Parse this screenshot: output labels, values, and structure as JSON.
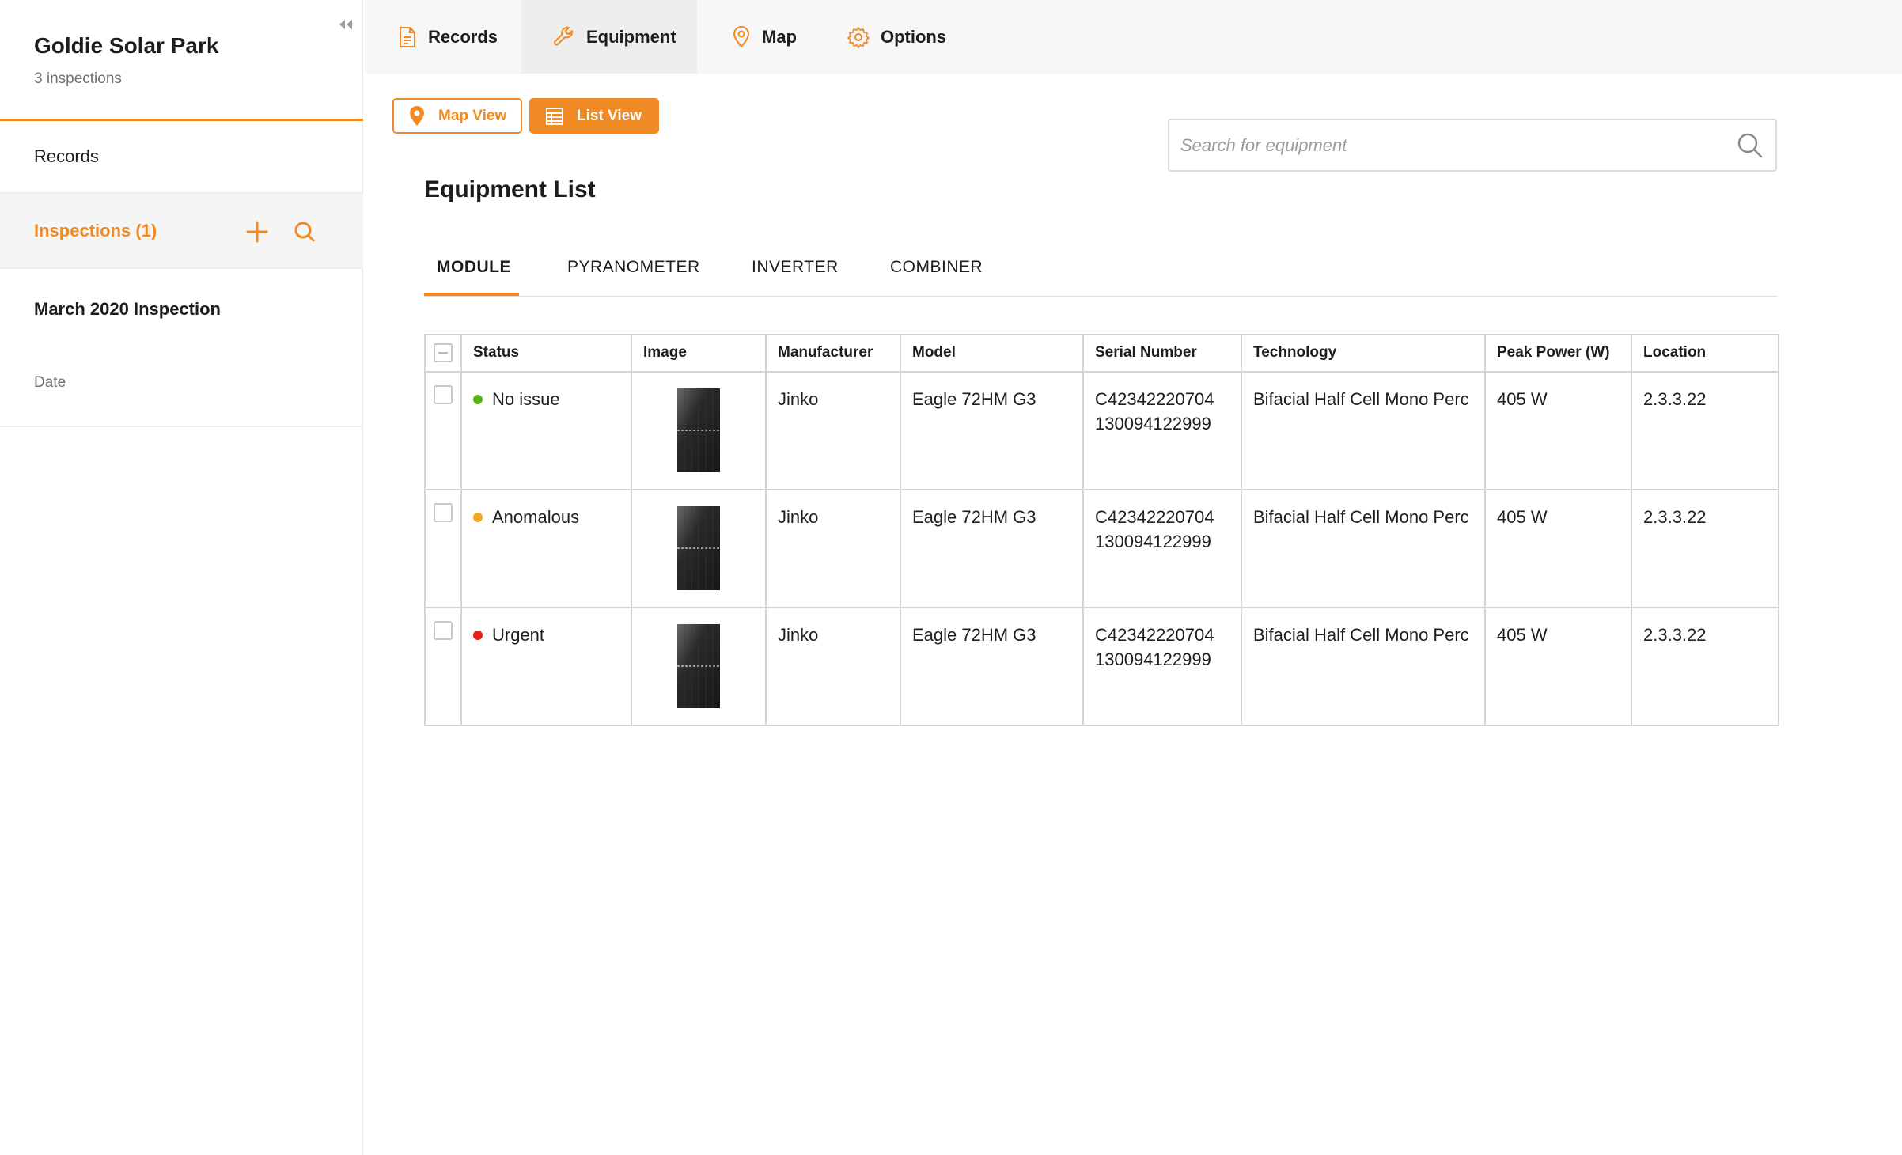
{
  "sidebar": {
    "site_title": "Goldie Solar Park",
    "site_subtitle": "3 inspections",
    "records_label": "Records",
    "inspections_label": "Inspections (1)",
    "inspection_item": {
      "title": "March 2020 Inspection",
      "date_label": "Date"
    }
  },
  "nav": {
    "tabs": [
      {
        "label": "Records",
        "icon": "document-icon"
      },
      {
        "label": "Equipment",
        "icon": "wrench-icon"
      },
      {
        "label": "Map",
        "icon": "map-pin-icon"
      },
      {
        "label": "Options",
        "icon": "gear-icon"
      }
    ],
    "active": "Equipment"
  },
  "view_toggle": {
    "map_label": "Map View",
    "list_label": "List View",
    "active": "List View"
  },
  "search": {
    "placeholder": "Search for equipment",
    "value": ""
  },
  "equipment": {
    "title": "Equipment List",
    "tabs": [
      "MODULE",
      "PYRANOMETER",
      "INVERTER",
      "COMBINER"
    ],
    "active_tab": "MODULE"
  },
  "table": {
    "columns": [
      "Status",
      "Image",
      "Manufacturer",
      "Model",
      "Serial Number",
      "Technology",
      "Peak Power (W)",
      "Location"
    ],
    "rows": [
      {
        "status": "No issue",
        "status_color": "#5bb318",
        "manufacturer": "Jinko",
        "model": "Eagle 72HM G3",
        "serial_1": "C42342220704",
        "serial_2": "130094122999",
        "technology": "Bifacial Half Cell Mono Perc",
        "peak_power": "405 W",
        "location": "2.3.3.22"
      },
      {
        "status": "Anomalous",
        "status_color": "#f5a623",
        "manufacturer": "Jinko",
        "model": "Eagle 72HM G3",
        "serial_1": "C42342220704",
        "serial_2": "130094122999",
        "technology": "Bifacial Half Cell Mono Perc",
        "peak_power": "405 W",
        "location": "2.3.3.22"
      },
      {
        "status": "Urgent",
        "status_color": "#e8221b",
        "manufacturer": "Jinko",
        "model": "Eagle 72HM G3",
        "serial_1": "C42342220704",
        "serial_2": "130094122999",
        "technology": "Bifacial Half Cell Mono Perc",
        "peak_power": "405 W",
        "location": "2.3.3.22"
      }
    ]
  },
  "colors": {
    "accent": "#f08a24"
  }
}
